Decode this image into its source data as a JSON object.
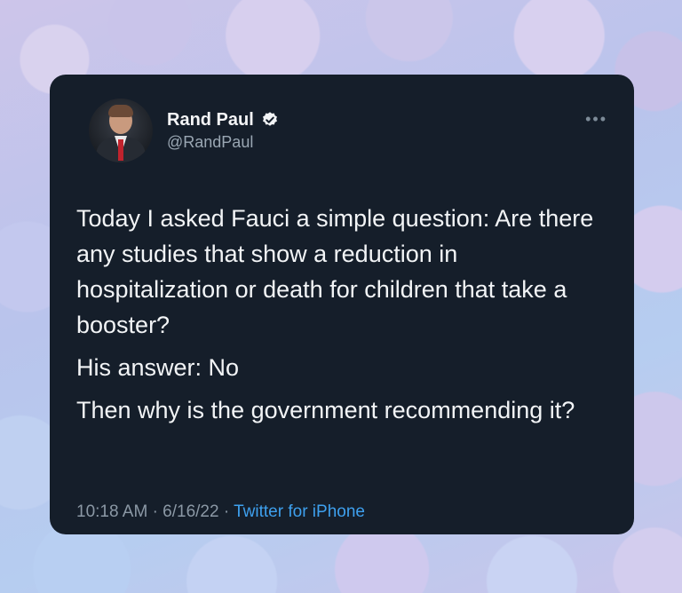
{
  "author": {
    "display_name": "Rand Paul",
    "handle": "@RandPaul"
  },
  "tweet": {
    "paragraphs": [
      "Today I asked Fauci a simple question: Are there any studies that show a reduction in hospitalization or death for children that take a booster?",
      "His answer: No",
      "Then why is the government recommending it?"
    ],
    "time": "10:18 AM",
    "separator": "·",
    "date": "6/16/22",
    "source": "Twitter for iPhone"
  },
  "icons": {
    "verified": "verified-badge-icon",
    "more": "more-options-icon"
  },
  "colors": {
    "card_background": "#151e2a",
    "link": "#3ea0ee",
    "secondary_text": "#8b98a5"
  }
}
